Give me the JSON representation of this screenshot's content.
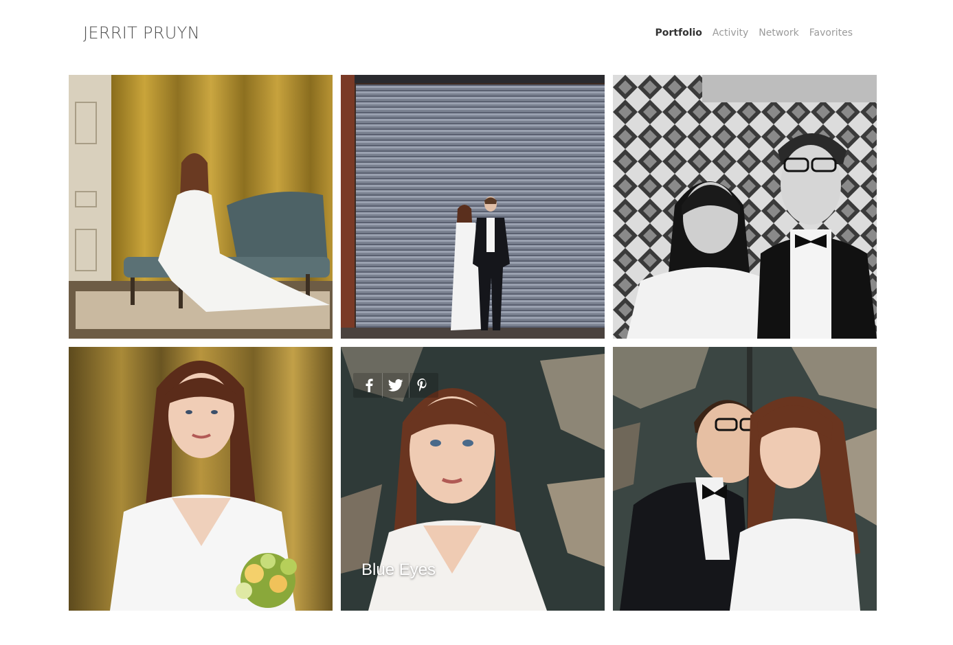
{
  "header": {
    "brand": "JERRIT PRUYN",
    "nav": [
      {
        "label": "Portfolio",
        "active": true
      },
      {
        "label": "Activity",
        "active": false
      },
      {
        "label": "Network",
        "active": false
      },
      {
        "label": "Favorites",
        "active": false
      }
    ]
  },
  "gallery": {
    "hover_caption": "Blue Eyes",
    "share_icons": [
      "facebook-icon",
      "twitter-icon",
      "pinterest-icon"
    ]
  },
  "colors": {
    "brand_text": "#4f4f4f",
    "nav_active": "#333333",
    "nav_inactive": "#9a9a9a",
    "caption": "#ffffff"
  }
}
